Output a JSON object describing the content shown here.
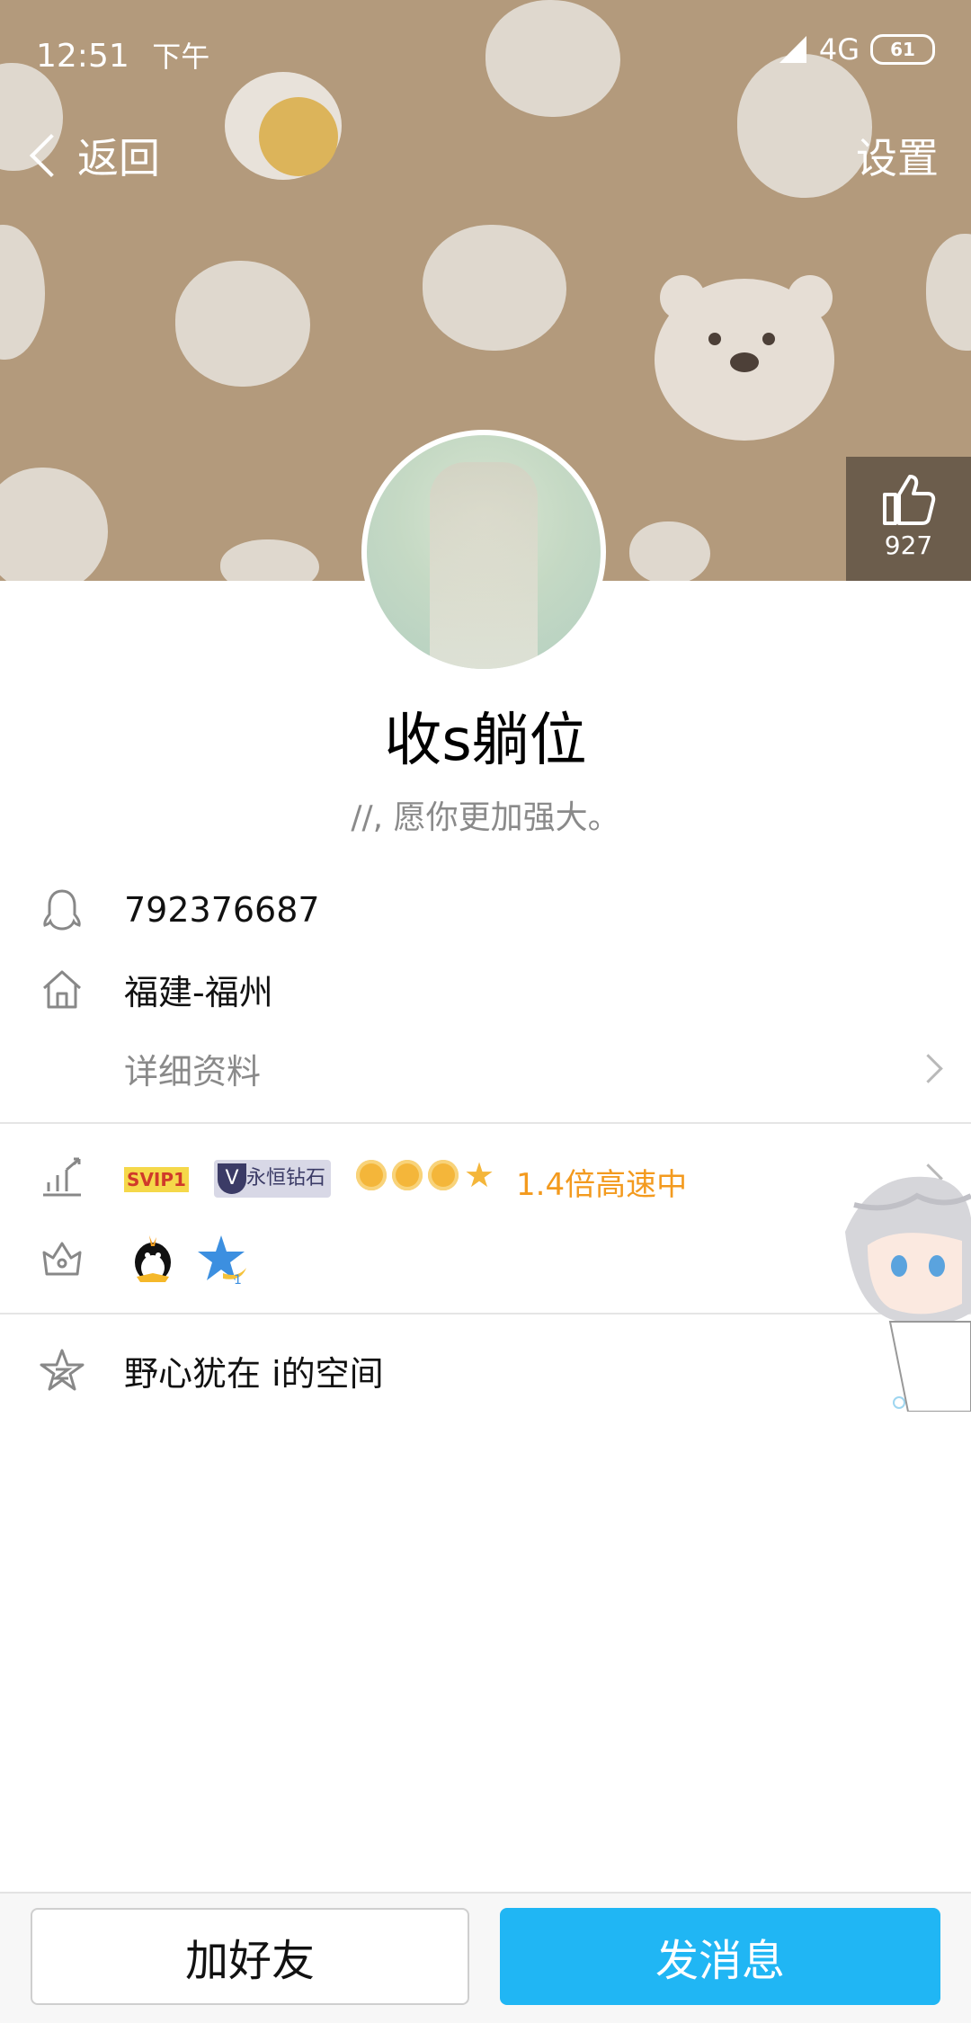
{
  "status_bar": {
    "time": "12:51",
    "ampm": "下午",
    "network": "4G",
    "battery": "61"
  },
  "nav": {
    "back_label": "返回",
    "settings_label": "设置"
  },
  "like": {
    "count": "927"
  },
  "profile": {
    "name": "收s躺位",
    "signature": "//, 愿你更加强大。"
  },
  "info": {
    "qq_number": "792376687",
    "location": "福建-福州",
    "details_label": "详细资料"
  },
  "vip": {
    "svip_badge": "SVIP1",
    "diamond_badge": "永恒钻石",
    "diamond_v": "V",
    "speed_text": "1.4倍高速中"
  },
  "space": {
    "label": "野心犹在 i的空间"
  },
  "actions": {
    "add_friend": "加好友",
    "send_message": "发消息"
  },
  "colors": {
    "accent": "#20b6f4",
    "speed_orange": "#f39a1e",
    "cover_bg": "#b39a7c"
  }
}
